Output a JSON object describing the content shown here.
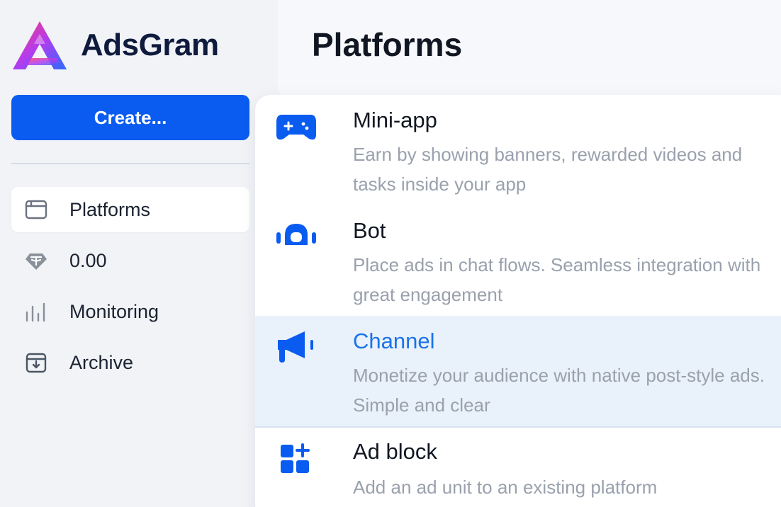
{
  "brand": {
    "name": "AdsGram"
  },
  "sidebar": {
    "create_label": "Create...",
    "nav": [
      {
        "icon": "browser-window-icon",
        "label": "Platforms",
        "active": true
      },
      {
        "icon": "tether-coin-icon",
        "label": "0.00",
        "active": false
      },
      {
        "icon": "bar-chart-icon",
        "label": "Monitoring",
        "active": false
      },
      {
        "icon": "archive-box-icon",
        "label": "Archive",
        "active": false
      }
    ]
  },
  "main": {
    "title": "Platforms"
  },
  "menu": {
    "items": [
      {
        "icon": "gamepad-icon",
        "title": "Mini-app",
        "description": "Earn by showing banners, rewarded videos and tasks inside your app"
      },
      {
        "icon": "robot-icon",
        "title": "Bot",
        "description": "Place ads in chat flows. Seamless integration with great engagement"
      },
      {
        "icon": "megaphone-icon",
        "title": "Channel",
        "description": "Monetize your audience with native post-style ads. Simple and clear",
        "highlighted": true
      },
      {
        "icon": "widgets-add-icon",
        "title": "Ad block",
        "description": "Add an ad unit to an existing platform"
      }
    ]
  },
  "colors": {
    "accent": "#0a5cf0",
    "highlight_text": "#1a73e8",
    "highlight_bg": "#e9f1fb",
    "sidebar_bg": "#f1f3f7"
  }
}
